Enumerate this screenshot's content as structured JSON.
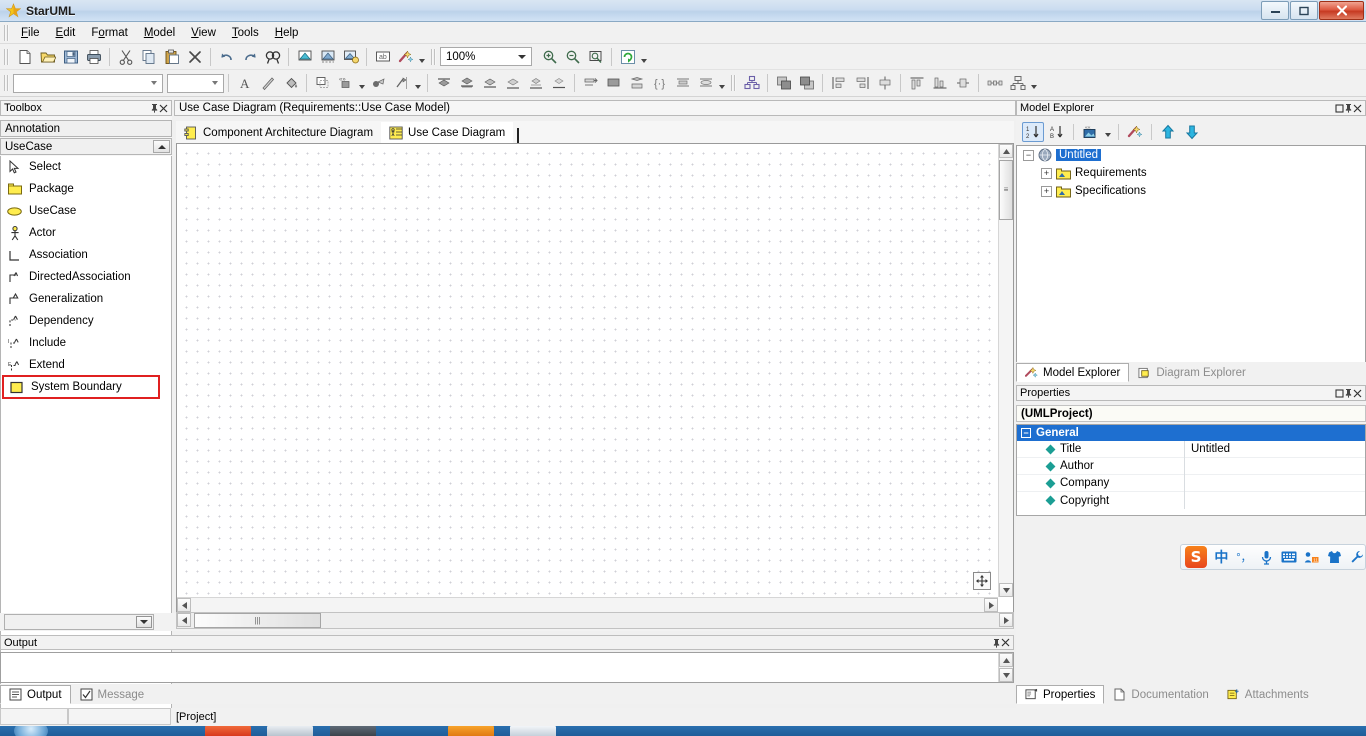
{
  "window": {
    "title": "StarUML",
    "icon": "star-icon",
    "buttons": {
      "minimize": "–",
      "maximize": "❑",
      "close": "✕"
    }
  },
  "menubar": {
    "items": [
      {
        "label": "File"
      },
      {
        "label": "Edit"
      },
      {
        "label": "Format"
      },
      {
        "label": "Model"
      },
      {
        "label": "View"
      },
      {
        "label": "Tools"
      },
      {
        "label": "Help"
      }
    ]
  },
  "toolbar_main": {
    "zoom_value": "100%",
    "groups": [
      {
        "icons": [
          "new-file-icon",
          "open-folder-icon",
          "save-icon",
          "print-icon"
        ]
      },
      {
        "icons": [
          "cut-icon",
          "copy-icon",
          "paste-icon",
          "delete-icon"
        ]
      },
      {
        "icons": [
          "undo-icon",
          "redo-icon",
          "find-icon"
        ]
      },
      {
        "icons": [
          "select-in-diagram-icon",
          "select-in-explorer-icon",
          "close-diagram-icon"
        ]
      },
      {
        "icons": [
          "documentation-icon",
          "validate-icon"
        ]
      },
      {
        "icons": [
          "zoom-in-icon",
          "zoom-out-icon",
          "fit-to-window-icon"
        ]
      },
      {
        "icons": [
          "refresh-icon"
        ]
      }
    ]
  },
  "toolbar_format": {
    "font_value": "",
    "size_value": "",
    "icons": [
      "font-color-icon",
      "line-color-icon",
      "fill-color-icon",
      "shadow-icon",
      "stereotype-display-icon",
      "line-style-icon",
      "line-arrow-icon",
      "align-top-icon",
      "align-middle-icon",
      "align-bottom-icon",
      "align-left-icon",
      "align-center-icon",
      "align-right-icon",
      "send-to-back-icon",
      "bring-to-front-icon",
      "group-icon",
      "brace-icon",
      "add-attribute-icon",
      "add-operation-icon",
      "auto-layout-icon",
      "bring-forward-icon",
      "send-backward-icon",
      "space-equal-v-icon",
      "space-equal-h-icon",
      "size-equal-icon",
      "width-equal-icon",
      "height-equal-icon",
      "fit-size-icon",
      "distribute-h-icon",
      "distribute-v-icon"
    ]
  },
  "toolbox": {
    "title": "Toolbox",
    "pin": "📌",
    "close": "✕",
    "groups": [
      {
        "label": "Annotation",
        "expanded": false
      },
      {
        "label": "UseCase",
        "expanded": true
      }
    ],
    "items": [
      {
        "label": "Select",
        "icon": "cursor-arrow-icon",
        "highlighted": false
      },
      {
        "label": "Package",
        "icon": "package-folder-icon",
        "highlighted": false
      },
      {
        "label": "UseCase",
        "icon": "usecase-ellipse-icon",
        "highlighted": false
      },
      {
        "label": "Actor",
        "icon": "actor-stickman-icon",
        "highlighted": false
      },
      {
        "label": "Association",
        "icon": "association-line-icon",
        "highlighted": false
      },
      {
        "label": "DirectedAssociation",
        "icon": "directed-association-icon",
        "highlighted": false
      },
      {
        "label": "Generalization",
        "icon": "generalization-arrow-icon",
        "highlighted": false
      },
      {
        "label": "Dependency",
        "icon": "dependency-dashed-icon",
        "highlighted": false
      },
      {
        "label": "Include",
        "icon": "include-icon",
        "highlighted": false
      },
      {
        "label": "Extend",
        "icon": "extend-icon",
        "highlighted": false
      },
      {
        "label": "System Boundary",
        "icon": "system-boundary-icon",
        "highlighted": true
      }
    ]
  },
  "diagram": {
    "title": "Use Case Diagram (Requirements::Use Case Model)",
    "tabs": [
      {
        "label": "Component Architecture Diagram",
        "icon": "component-diagram-icon",
        "active": false
      },
      {
        "label": "Use Case Diagram",
        "icon": "usecase-diagram-icon",
        "active": true
      }
    ],
    "pan_tool": "pan-move-icon",
    "bottom_combo_value": ""
  },
  "model_explorer": {
    "title": "Model Explorer",
    "restore": "❐",
    "pin": "📌",
    "close": "✕",
    "toolbar": [
      "sort-by-order-icon",
      "sort-alphabetic-icon",
      "view-options-icon",
      "select-in-diagram-icon",
      "move-up-icon",
      "move-down-icon"
    ],
    "tree": [
      {
        "label": "Untitled",
        "icon": "project-icon",
        "level": 0,
        "expander": "−",
        "selected": true
      },
      {
        "label": "Requirements",
        "icon": "model-folder-icon",
        "level": 1,
        "expander": "+",
        "selected": false
      },
      {
        "label": "Specifications",
        "icon": "model-folder-icon",
        "level": 1,
        "expander": "+",
        "selected": false
      }
    ],
    "tabs": [
      {
        "label": "Model Explorer",
        "icon": "model-explorer-icon",
        "active": true
      },
      {
        "label": "Diagram Explorer",
        "icon": "diagram-explorer-icon",
        "active": false
      }
    ]
  },
  "properties": {
    "title": "Properties",
    "restore": "❐",
    "pin": "📌",
    "close": "✕",
    "element_type": "(UMLProject)",
    "group": {
      "label": "General",
      "expander": "−"
    },
    "rows": [
      {
        "name": "Title",
        "value": "Untitled"
      },
      {
        "name": "Author",
        "value": ""
      },
      {
        "name": "Company",
        "value": ""
      },
      {
        "name": "Copyright",
        "value": ""
      }
    ],
    "tabs": [
      {
        "label": "Properties",
        "icon": "properties-icon",
        "active": true
      },
      {
        "label": "Documentation",
        "icon": "documentation-page-icon",
        "active": false
      },
      {
        "label": "Attachments",
        "icon": "attachments-icon",
        "active": false
      }
    ]
  },
  "output": {
    "title": "Output",
    "pin": "📌",
    "close": "✕",
    "content": "",
    "tabs": [
      {
        "label": "Output",
        "icon": "output-list-icon",
        "active": true
      },
      {
        "label": "Message",
        "icon": "message-check-icon",
        "active": false
      }
    ]
  },
  "statusbar": {
    "cell1": "",
    "cell2": "",
    "cell3": "[Project]"
  },
  "ime": {
    "logo": "S",
    "items": [
      {
        "icon": "chinese-mode-icon",
        "glyph": "中"
      },
      {
        "icon": "punctuation-icon",
        "glyph": "°，"
      },
      {
        "icon": "voice-input-icon",
        "glyph": "🎤"
      },
      {
        "icon": "soft-keyboard-icon",
        "glyph": "⌨"
      },
      {
        "icon": "input-method-switch-icon",
        "glyph": "☰"
      },
      {
        "icon": "skin-icon",
        "glyph": "👕"
      },
      {
        "icon": "settings-wrench-icon",
        "glyph": "🔧"
      }
    ]
  },
  "colors": {
    "accent": "#1e6fd0",
    "highlight_red": "#e02020",
    "toolbox_yellow": "#ffed4f",
    "title_gradient_start": "#d9e6f2"
  }
}
